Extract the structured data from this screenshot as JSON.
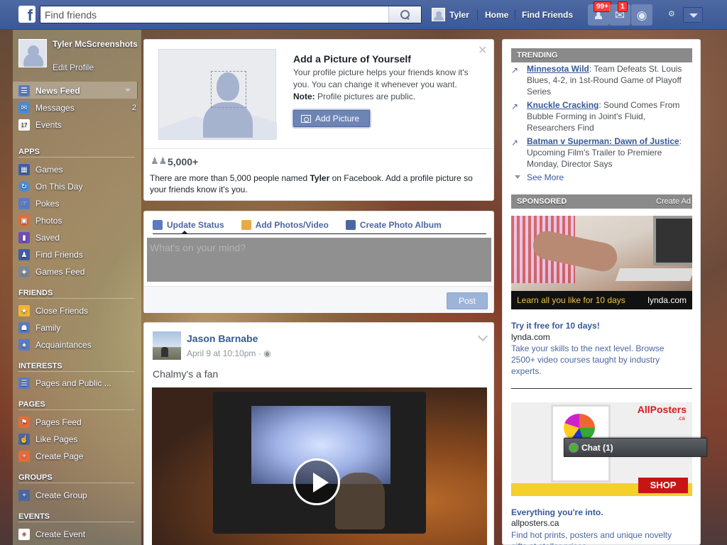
{
  "topbar": {
    "search_placeholder": "Find friends",
    "user_name": "Tyler",
    "home": "Home",
    "find_friends": "Find Friends",
    "friend_requests_badge": "99+",
    "messages_badge": "1"
  },
  "leftnav": {
    "profile_name": "Tyler McScreenshots",
    "edit_profile": "Edit Profile",
    "favorites": [
      {
        "label": "News Feed",
        "count": ""
      },
      {
        "label": "Messages",
        "count": "2"
      },
      {
        "label": "Events",
        "count": ""
      }
    ],
    "apps_header": "APPS",
    "apps": [
      "Games",
      "On This Day",
      "Pokes",
      "Photos",
      "Saved",
      "Find Friends",
      "Games Feed"
    ],
    "friends_header": "FRIENDS",
    "friends": [
      "Close Friends",
      "Family",
      "Acquaintances"
    ],
    "interests_header": "INTERESTS",
    "interests": [
      "Pages and Public ..."
    ],
    "pages_header": "PAGES",
    "pages": [
      "Pages Feed",
      "Like Pages",
      "Create Page"
    ],
    "groups_header": "GROUPS",
    "groups": [
      "Create Group"
    ],
    "events_header": "EVENTS",
    "events": [
      "Create Event"
    ]
  },
  "profile_card": {
    "title": "Add a Picture of Yourself",
    "text": "Your profile picture helps your friends know it's you. You can change it whenever you want.",
    "note_label": "Note:",
    "note_text": " Profile pictures are public.",
    "button": "Add Picture",
    "count": "5,000+",
    "people_text_pre": "There are more than 5,000 people named ",
    "people_text_name": "Tyler",
    "people_text_post": " on Facebook. Add a profile picture so your friends know it's you."
  },
  "composer": {
    "tabs": [
      "Update Status",
      "Add Photos/Video",
      "Create Photo Album"
    ],
    "placeholder": "What's on your mind?",
    "post_button": "Post"
  },
  "post": {
    "author": "Jason Barnabe",
    "time": "April 9 at 10:10pm · ",
    "text": "Chalmy's a fan"
  },
  "right": {
    "trending_header": "TRENDING",
    "trending": [
      {
        "topic": "Minnesota Wild",
        "desc": ": Team Defeats St. Louis Blues, 4-2, in 1st-Round Game of Playoff Series"
      },
      {
        "topic": "Knuckle Cracking",
        "desc": ": Sound Comes From Bubble Forming in Joint's Fluid, Researchers Find"
      },
      {
        "topic": "Batman v Superman: Dawn of Justice",
        "desc": ": Upcoming Film's Trailer to Premiere Monday, Director Says"
      }
    ],
    "see_more": "See More",
    "sponsored_header": "SPONSORED",
    "create_ad": "Create Ad",
    "ad1": {
      "banner": "Learn all you like for 10 days",
      "brand": "lynda.com",
      "title": "Try it free for 10 days!",
      "domain": "lynda.com",
      "desc": "Take your skills to the next level. Browse 2500+ video courses taught by industry experts."
    },
    "ad2": {
      "logo": "AllPosters",
      "logo_sub": ".ca",
      "cta": "SHOP NOW",
      "title": "Everything you're into.",
      "domain": "allposters.ca",
      "desc": "Find hot prints, posters and unique novelty gifts at stellar prices."
    }
  },
  "chat": {
    "label": "Chat (1)"
  }
}
